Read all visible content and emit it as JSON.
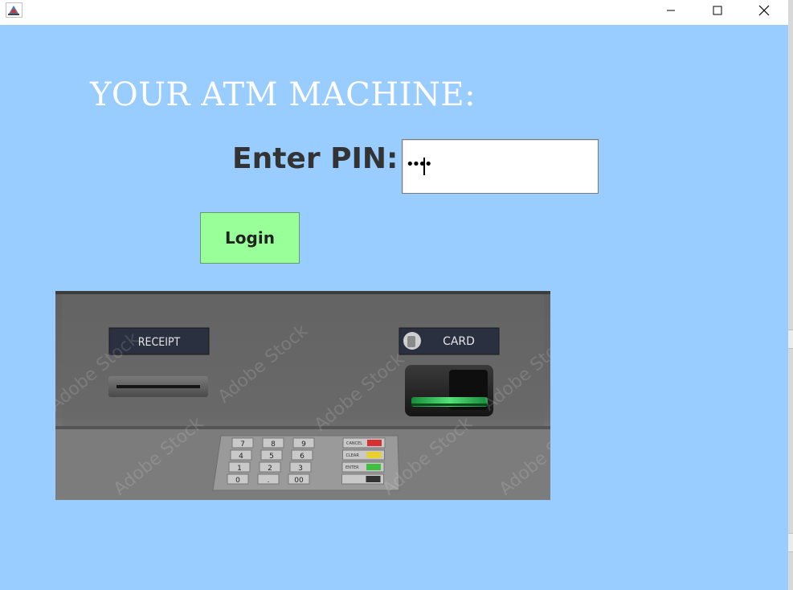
{
  "window": {
    "icon": "java-cup-icon",
    "controls": {
      "minimize": "minimize-icon",
      "maximize": "maximize-icon",
      "close": "close-icon"
    }
  },
  "main": {
    "heading": "YOUR ATM MACHINE:",
    "pin_label": "Enter PIN:",
    "pin_value": "••••",
    "login_label": "Login"
  },
  "atm_image": {
    "receipt_label": "RECEIPT",
    "card_label": "CARD",
    "watermark": "Adobe Stock",
    "keys": [
      "7",
      "8",
      "9",
      "4",
      "5",
      "6",
      "1",
      "2",
      "3",
      "0",
      ".",
      "00"
    ],
    "function_keys": [
      "CANCEL",
      "CLEAR",
      "ENTER",
      ""
    ],
    "function_colors": [
      "#d83030",
      "#e8d030",
      "#40c040",
      "#333333"
    ]
  },
  "colors": {
    "background": "#99ccff",
    "heading": "#ffffff",
    "login_button": "#99ff99"
  }
}
